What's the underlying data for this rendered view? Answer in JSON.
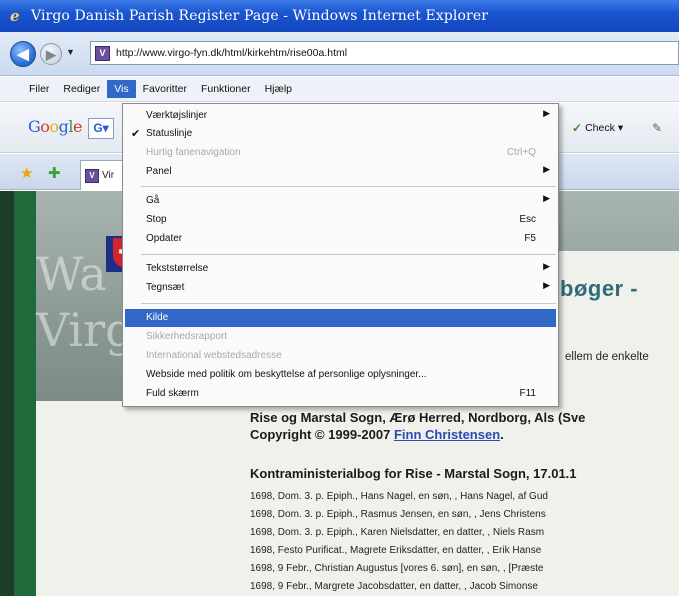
{
  "window": {
    "title": "Virgo Danish Parish Register Page - Windows Internet Explorer"
  },
  "address": {
    "url": "http://www.virgo-fyn.dk/html/kirkehtm/rise00a.html"
  },
  "menubar": [
    "Filer",
    "Rediger",
    "Vis",
    "Favoritter",
    "Funktioner",
    "Hjælp"
  ],
  "google_toolbar": {
    "logo": "Google",
    "g_button": "G",
    "check_label": "Check"
  },
  "tab": {
    "label": "Vir"
  },
  "view_menu": {
    "items": [
      {
        "label": "Værktøjslinjer",
        "shortcut": "",
        "submenu": true,
        "checked": false,
        "disabled": false
      },
      {
        "label": "Statuslinje",
        "shortcut": "",
        "submenu": false,
        "checked": true,
        "disabled": false
      },
      {
        "label": "Hurtig fanenavigation",
        "shortcut": "Ctrl+Q",
        "submenu": false,
        "checked": false,
        "disabled": true
      },
      {
        "label": "Panel",
        "shortcut": "",
        "submenu": true,
        "checked": false,
        "disabled": false
      },
      {
        "label": "Gå",
        "shortcut": "",
        "submenu": true,
        "checked": false,
        "disabled": false
      },
      {
        "label": "Stop",
        "shortcut": "Esc",
        "submenu": false,
        "checked": false,
        "disabled": false
      },
      {
        "label": "Opdater",
        "shortcut": "F5",
        "submenu": false,
        "checked": false,
        "disabled": false
      },
      {
        "label": "Tekststørrelse",
        "shortcut": "",
        "submenu": true,
        "checked": false,
        "disabled": false
      },
      {
        "label": "Tegnsæt",
        "shortcut": "",
        "submenu": true,
        "checked": false,
        "disabled": false
      },
      {
        "label": "Kilde",
        "shortcut": "",
        "submenu": false,
        "checked": false,
        "disabled": false,
        "highlighted": true
      },
      {
        "label": "Sikkerhedsrapport",
        "shortcut": "",
        "submenu": false,
        "checked": false,
        "disabled": true
      },
      {
        "label": "International webstedsadresse",
        "shortcut": "",
        "submenu": false,
        "checked": false,
        "disabled": true
      },
      {
        "label": "Webside med politik om beskyttelse af personlige oplysninger...",
        "shortcut": "",
        "submenu": false,
        "checked": false,
        "disabled": false
      },
      {
        "label": "Fuld skærm",
        "shortcut": "F11",
        "submenu": false,
        "checked": false,
        "disabled": false
      }
    ]
  },
  "page": {
    "hero_text": "Wa\nVirgo",
    "heading_fragment": "bøger -",
    "intro_fragment": "ellem de enkelte",
    "copyright_line1": "Rise og Marstal Sogn, Ærø Herred, Nordborg, Als (Sve",
    "copyright_prefix": "Copyright © 1999-2007 ",
    "copyright_author": "Finn Christensen",
    "copyright_suffix": ".",
    "section_title": "Kontraministerialbog for Rise - Marstal Sogn, 17.01.1",
    "records": [
      "1698, Dom. 3. p. Epiph., Hans Nagel, en søn, , Hans Nagel, af Gud",
      "1698, Dom. 3. p. Epiph., Rasmus Jensen, en søn, , Jens Christens",
      "1698, Dom. 3. p. Epiph., Karen Nielsdatter, en datter, , Niels Rasm",
      "1698, Festo Purificat., Magrete Eriksdatter, en datter, , Erik Hanse",
      "1698, 9 Febr., Christian Augustus [vores 6. søn], en søn, , [Præste",
      "1698, 9 Febr., Margrete Jacobsdatter, en datter, , Jacob Simonse"
    ]
  }
}
